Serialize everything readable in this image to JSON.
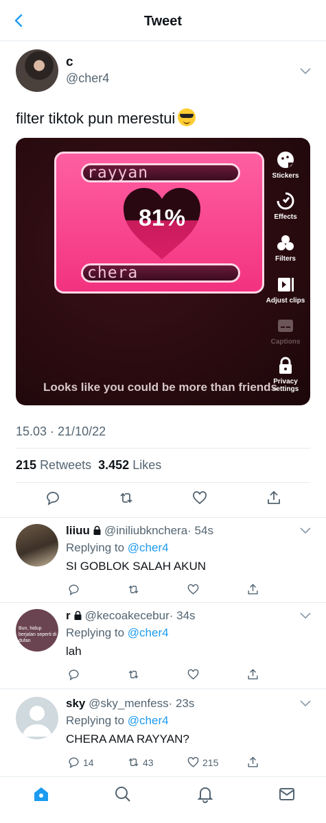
{
  "header": {
    "title": "Tweet"
  },
  "tweet": {
    "name": "c",
    "handle": "@cher4",
    "text": "filter tiktok pun merestui",
    "media": {
      "name_top": "rayyan",
      "name_bottom": "chera",
      "percent": "81%",
      "caption": "Looks like you could be more than friends",
      "side_buttons": [
        "Stickers",
        "Effects",
        "Filters",
        "Adjust clips",
        "Captions",
        "Privacy settings"
      ]
    },
    "timestamp": "15.03 · 21/10/22",
    "retweets_count": "215",
    "retweets_label": "Retweets",
    "likes_count": "3.452",
    "likes_label": "Likes"
  },
  "replies": [
    {
      "name": "liiuu",
      "handle": "@iniliubknchera",
      "time": "· 54s",
      "replying_prefix": "Replying to",
      "replying_to": "@cher4",
      "text": "SI GOBLOK SALAH AKUN",
      "replies": "",
      "retweets": "",
      "likes": ""
    },
    {
      "name": "r",
      "handle": "@kecoakecebur",
      "time": "· 34s",
      "replying_prefix": "Replying to",
      "replying_to": "@cher4",
      "text": "lah",
      "replies": "",
      "retweets": "",
      "likes": "",
      "avatar_text": "Bun, hidup berjalan seperti di dufan"
    },
    {
      "name": "sky",
      "handle": "@sky_menfess",
      "time": "· 23s",
      "replying_prefix": "Replying to",
      "replying_to": "@cher4",
      "text": "CHERA AMA RAYYAN?",
      "replies": "14",
      "retweets": "43",
      "likes": "215"
    }
  ],
  "colors": {
    "accent": "#1d9bf0",
    "pink": "#f2327f",
    "muted": "#536471"
  }
}
